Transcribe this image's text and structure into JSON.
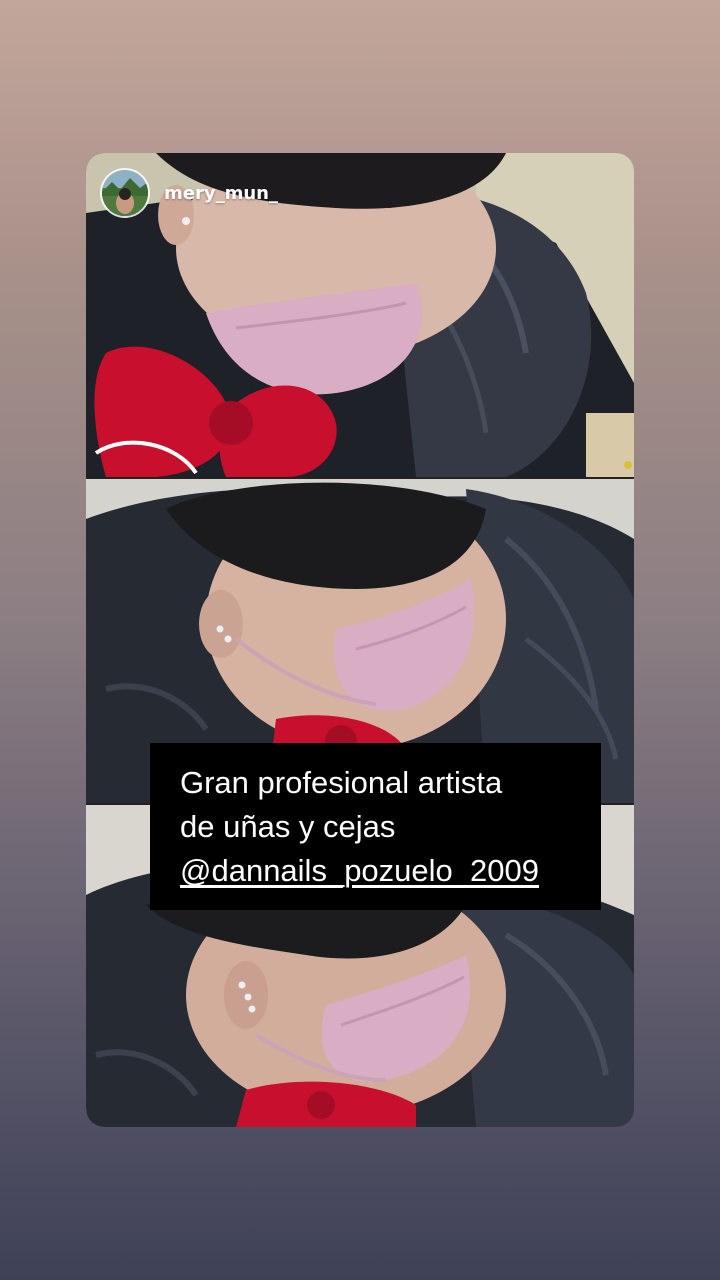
{
  "story": {
    "username": "mery_mun_",
    "avatar_icon": "profile-avatar",
    "photos": [
      {
        "label": "woman-in-pink-mask-top-view"
      },
      {
        "label": "woman-in-pink-mask-side-view"
      },
      {
        "label": "woman-in-pink-mask-ear-piercings"
      }
    ],
    "caption": {
      "line1": "Gran profesional  artista",
      "line2": "de uñas y cejas",
      "mention": "@dannails_pozuelo_2009"
    }
  },
  "colors": {
    "bg_top": "#c2a69b",
    "bg_bottom": "#3e4157",
    "caption_bg": "#000000",
    "mask_pink": "#d9aec4",
    "cape": "#2f333d"
  }
}
